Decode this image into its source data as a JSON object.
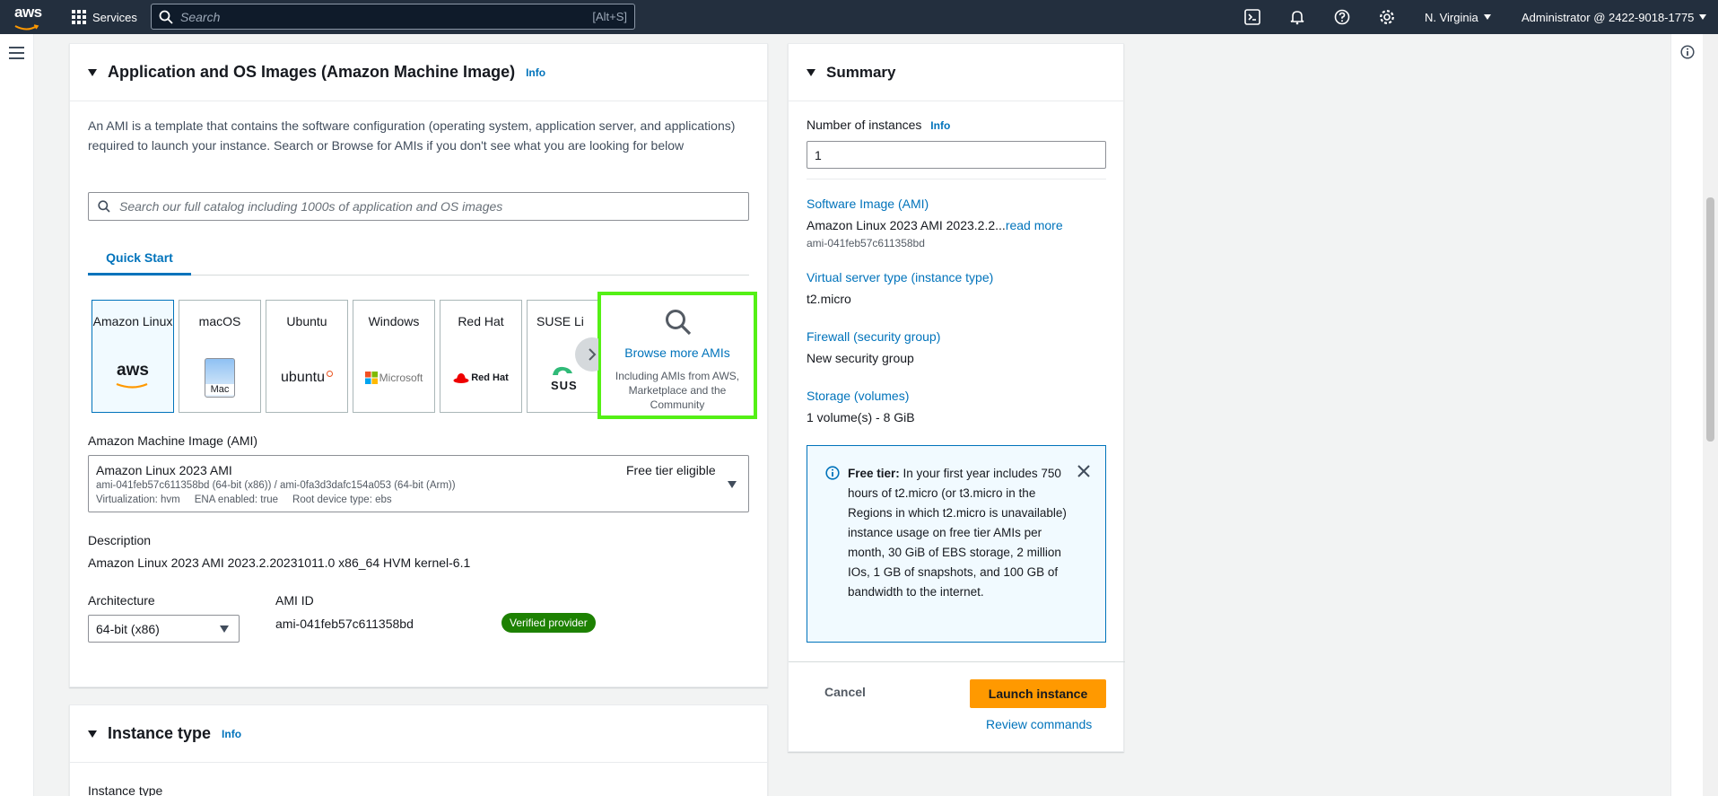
{
  "topnav": {
    "logo_text": "aws",
    "services_label": "Services",
    "search_placeholder": "Search",
    "search_shortcut": "[Alt+S]",
    "region": "N. Virginia",
    "account": "Administrator @ 2422-9018-1775",
    "icons": [
      "cloudshell-icon",
      "bell-icon",
      "help-icon",
      "gear-icon"
    ]
  },
  "ami_section": {
    "title": "Application and OS Images (Amazon Machine Image)",
    "info": "Info",
    "description": "An AMI is a template that contains the software configuration (operating system, application server, and applications) required to launch your instance. Search or Browse for AMIs if you don't see what you are looking for below",
    "catalog_placeholder": "Search our full catalog including 1000s of application and OS images",
    "tab": "Quick Start",
    "os_options": [
      {
        "label": "Amazon Linux",
        "logo": "aws"
      },
      {
        "label": "macOS",
        "logo": "Mac"
      },
      {
        "label": "Ubuntu",
        "logo": "ubuntu"
      },
      {
        "label": "Windows",
        "logo": "Microsoft"
      },
      {
        "label": "Red Hat",
        "logo": "Red Hat"
      },
      {
        "label": "SUSE Li",
        "logo": "SUS"
      }
    ],
    "browse_title": "Browse more AMIs",
    "browse_sub": "Including AMIs from AWS, Marketplace and the Community",
    "ami_label": "Amazon Machine Image (AMI)",
    "ami_name": "Amazon Linux 2023 AMI",
    "ami_ids": "ami-041feb57c611358bd (64-bit (x86)) / ami-0fa3d3dafc154a053 (64-bit (Arm))",
    "ami_meta": "Virtualization: hvm     ENA enabled: true     Root device type: ebs",
    "free_tier": "Free tier eligible",
    "description_label": "Description",
    "description_value": "Amazon Linux 2023 AMI 2023.2.20231011.0 x86_64 HVM kernel-6.1",
    "architecture_label": "Architecture",
    "architecture_value": "64-bit (x86)",
    "ami_id_label": "AMI ID",
    "ami_id_value": "ami-041feb57c611358bd",
    "verified": "Verified provider"
  },
  "instance_type_section": {
    "title": "Instance type",
    "info": "Info",
    "field_label": "Instance type"
  },
  "summary": {
    "title": "Summary",
    "instances_label": "Number of instances",
    "info": "Info",
    "instances_value": "1",
    "software_image_label": "Software Image (AMI)",
    "software_image_value": "Amazon Linux 2023 AMI 2023.2.2...",
    "read_more": "read more",
    "software_image_id": "ami-041feb57c611358bd",
    "server_type_label": "Virtual server type (instance type)",
    "server_type_value": "t2.micro",
    "firewall_label": "Firewall (security group)",
    "firewall_value": "New security group",
    "storage_label": "Storage (volumes)",
    "storage_value": "1 volume(s) - 8 GiB",
    "free_tier_title": "Free tier:",
    "free_tier_text": "In your first year includes 750 hours of t2.micro (or t3.micro in the Regions in which t2.micro is unavailable) instance usage on free tier AMIs per month, 30 GiB of EBS storage, 2 million IOs, 1 GB of snapshots, and 100 GB of bandwidth to the internet.",
    "cancel": "Cancel",
    "launch": "Launch instance",
    "review": "Review commands"
  },
  "colors": {
    "nav_bg": "#232f3e",
    "link": "#0073bb",
    "primary": "#ff9900",
    "highlight": "#54f015",
    "verified": "#1d8102"
  }
}
